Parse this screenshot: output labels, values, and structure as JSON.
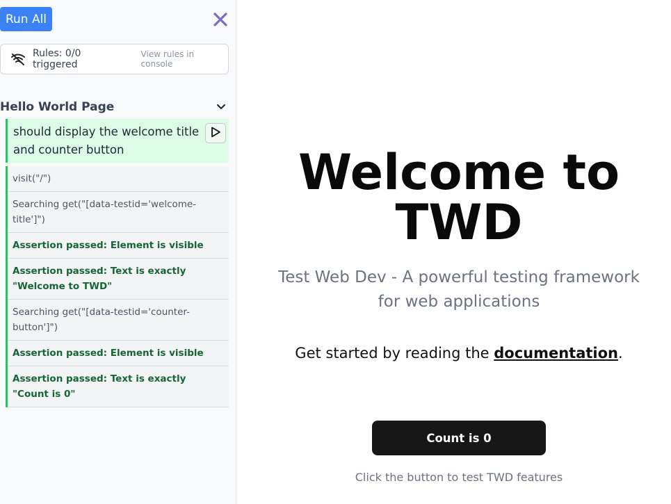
{
  "sidebar": {
    "run_all_label": "Run All",
    "close_icon": "close-x-icon",
    "rules": {
      "icon": "wifi-signal-icon",
      "text": "Rules: 0/0 triggered",
      "link": "View rules in console"
    },
    "suite": {
      "title": "Hello World Page",
      "expanded": true,
      "test": {
        "title": "should display the welcome title and counter button",
        "status": "passed",
        "steps": [
          {
            "text": "visit(\"/\")",
            "type": "command"
          },
          {
            "text": "Searching get(\"[data-testid='welcome-title']\")",
            "type": "command"
          },
          {
            "text": "Assertion passed: Element is visible",
            "type": "pass"
          },
          {
            "text": "Assertion passed: Text is exactly \"Welcome to TWD\"",
            "type": "pass"
          },
          {
            "text": "Searching get(\"[data-testid='counter-button']\")",
            "type": "command"
          },
          {
            "text": "Assertion passed: Element is visible",
            "type": "pass"
          },
          {
            "text": "Assertion passed: Text is exactly \"Count is 0\"",
            "type": "pass"
          }
        ]
      }
    }
  },
  "main": {
    "title_line1": "Welcome to",
    "title_line2": "TWD",
    "subtitle": "Test Web Dev - A powerful testing framework for web applications",
    "started_prefix": "Get started by reading the ",
    "started_link": "documentation",
    "started_suffix": ".",
    "count_button": "Count is 0",
    "hint": "Click the button to test TWD features"
  },
  "colors": {
    "accent": "#3b82f6",
    "close": "#7c6bc4",
    "pass_green": "#22c55e",
    "pass_text": "#166534",
    "pass_bg": "#dcfce7"
  }
}
